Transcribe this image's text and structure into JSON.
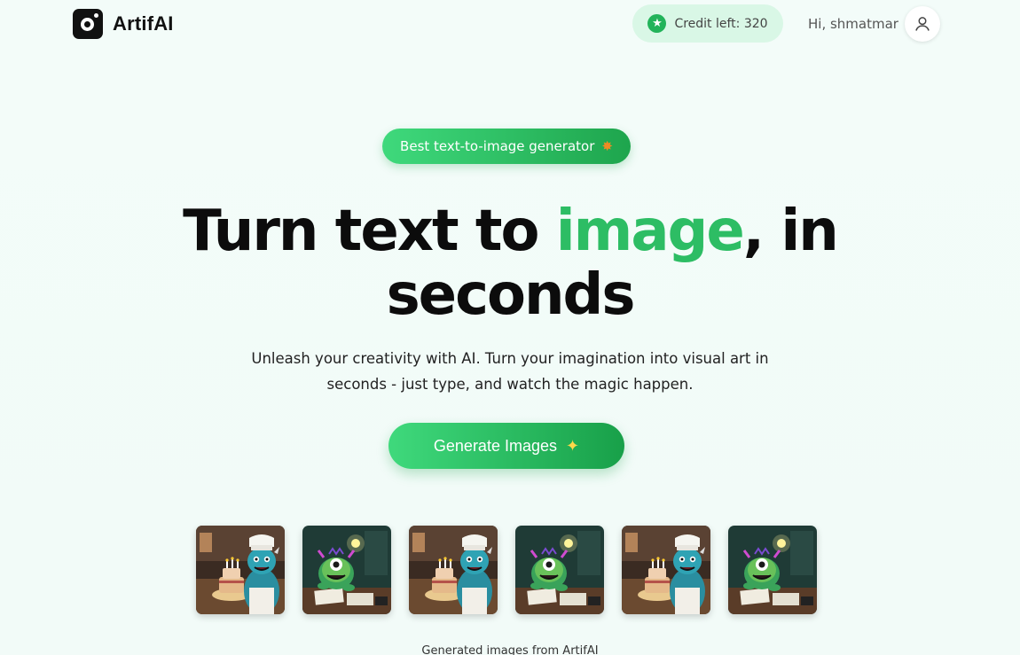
{
  "header": {
    "brand": "ArtifAI",
    "credit_label": "Credit left: 320",
    "greeting": "Hi, shmatmar",
    "icons": {
      "logo": "logo-icon",
      "credit": "star-icon",
      "avatar": "user-icon"
    }
  },
  "hero": {
    "badge_label": "Best text-to-image generator",
    "badge_icon": "star-icon",
    "headline_pre": "Turn text to ",
    "headline_highlight": "image",
    "headline_post": ", in",
    "headline_line2": "seconds",
    "subtitle_line1": "Unleash your creativity with AI. Turn your imagination into visual art in",
    "subtitle_line2": "seconds - just type, and watch the magic happen.",
    "cta_label": "Generate Images",
    "cta_icon": "sparkles-icon"
  },
  "gallery": {
    "thumbnails": [
      {
        "subject": "monster-chef-cake"
      },
      {
        "subject": "monster-desk-lamp"
      },
      {
        "subject": "monster-chef-cake"
      },
      {
        "subject": "monster-desk-lamp"
      },
      {
        "subject": "monster-chef-cake"
      },
      {
        "subject": "monster-desk-lamp"
      }
    ],
    "caption": "Generated images from ArtifAI"
  },
  "colors": {
    "accent": "#2dbd64",
    "accent_gradient_start": "#3fd97c",
    "accent_gradient_end": "#18a049",
    "credit_bg": "#d9f7e6",
    "page_bg": "#f3fcf9"
  }
}
